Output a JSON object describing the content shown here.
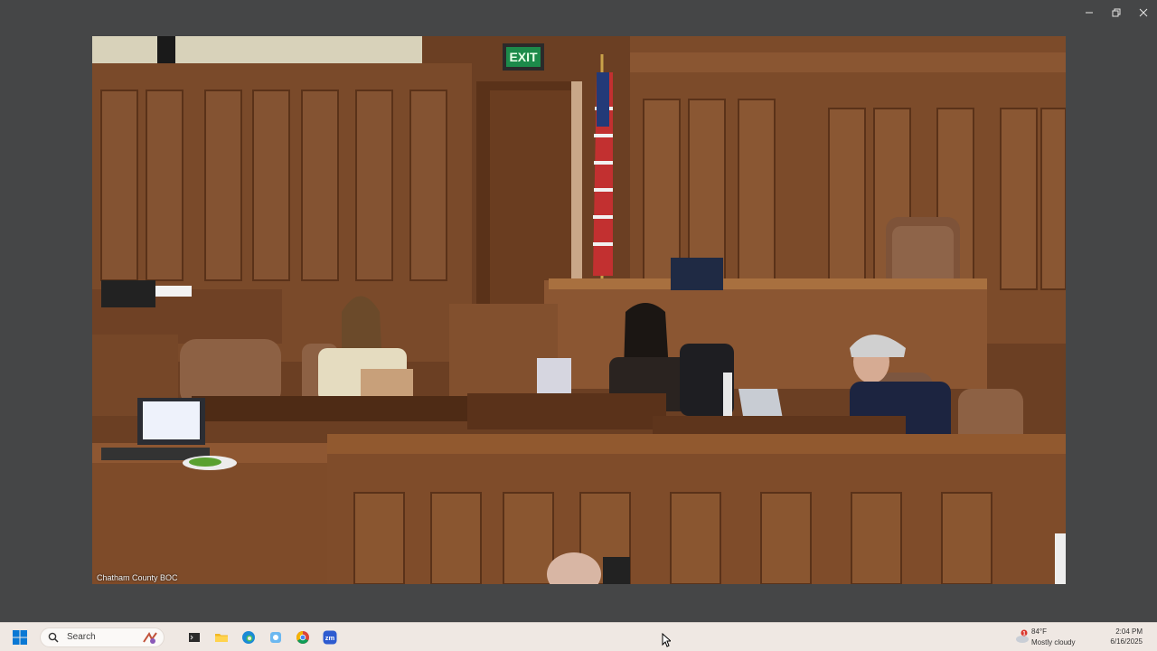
{
  "window": {
    "controls": [
      "minimize-icon",
      "restore-icon",
      "close-icon"
    ]
  },
  "video": {
    "source_label": "Chatham County BOC",
    "exit_sign": "EXIT"
  },
  "taskbar": {
    "search_placeholder": "Search",
    "apps": [
      "windows-start-icon",
      "file-explorer-icon",
      "terminal-icon",
      "folder-icon",
      "edge-icon",
      "copilot-icon",
      "chrome-icon",
      "zoom-icon"
    ],
    "zoom_label": "zm",
    "weather": {
      "temperature": "84°F",
      "condition": "Mostly cloudy",
      "alert_count": "1"
    },
    "clock": {
      "time": "2:04 PM",
      "date": "6/16/2025"
    }
  },
  "colors": {
    "background": "#454647",
    "taskbar": "#efe8e3",
    "windows_blue": "#0a78d4",
    "zoom_blue": "#2d5bd0"
  }
}
